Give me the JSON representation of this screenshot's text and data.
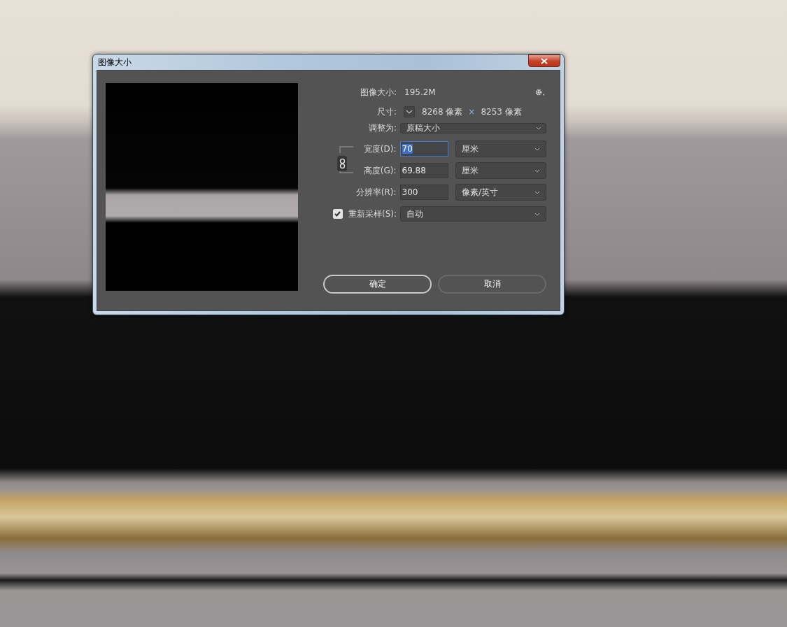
{
  "window": {
    "title": "图像大小"
  },
  "image_size": {
    "label": "图像大小:",
    "value": "195.2M"
  },
  "dimensions": {
    "label": "尺寸:",
    "width": "8268 像素",
    "separator": "×",
    "height": "8253 像素"
  },
  "fit_to": {
    "label": "调整为:",
    "value": "原稿大小"
  },
  "fields": [
    {
      "label": "宽度(D):",
      "value": "70",
      "selected": true,
      "unit": "厘米"
    },
    {
      "label": "高度(G):",
      "value": "69.88",
      "selected": false,
      "unit": "厘米"
    },
    {
      "label": "分辨率(R):",
      "value": "300",
      "selected": false,
      "unit": "像素/英寸"
    }
  ],
  "constrain_proportions": {
    "on": true
  },
  "resample": {
    "label": "重新采样(S):",
    "checked": true,
    "value": "自动"
  },
  "buttons": [
    {
      "label": "确定",
      "default": true
    },
    {
      "label": "取消",
      "default": false
    }
  ]
}
